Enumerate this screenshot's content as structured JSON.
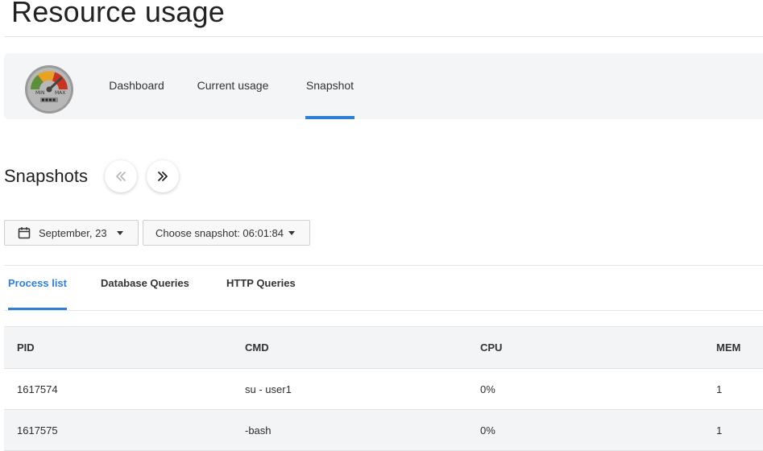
{
  "header": {
    "title": "Resource usage"
  },
  "nav": {
    "logo": {
      "min_label": "MIN",
      "max_label": "MAX"
    },
    "tabs": [
      {
        "label": "Dashboard",
        "active": false
      },
      {
        "label": "Current usage",
        "active": false
      },
      {
        "label": "Snapshot",
        "active": true
      }
    ]
  },
  "snapshots": {
    "title": "Snapshots",
    "prev_icon": "double-chevron-left-icon",
    "next_icon": "double-chevron-right-icon",
    "date_dropdown": {
      "icon": "calendar-icon",
      "value": "September, 23"
    },
    "snapshot_dropdown": {
      "value": "Choose snapshot: 06:01:84"
    }
  },
  "sub_tabs": [
    {
      "label": "Process list",
      "active": true
    },
    {
      "label": "Database Queries",
      "active": false
    },
    {
      "label": "HTTP Queries",
      "active": false
    }
  ],
  "table": {
    "columns": [
      "PID",
      "CMD",
      "CPU",
      "MEM"
    ],
    "rows": [
      [
        "1617574",
        "su - user1",
        "0%",
        "1"
      ],
      [
        "1617575",
        "-bash",
        "0%",
        "1"
      ]
    ]
  },
  "colors": {
    "accent": "#2f7fd6",
    "panel_bg": "#f4f5f7"
  }
}
